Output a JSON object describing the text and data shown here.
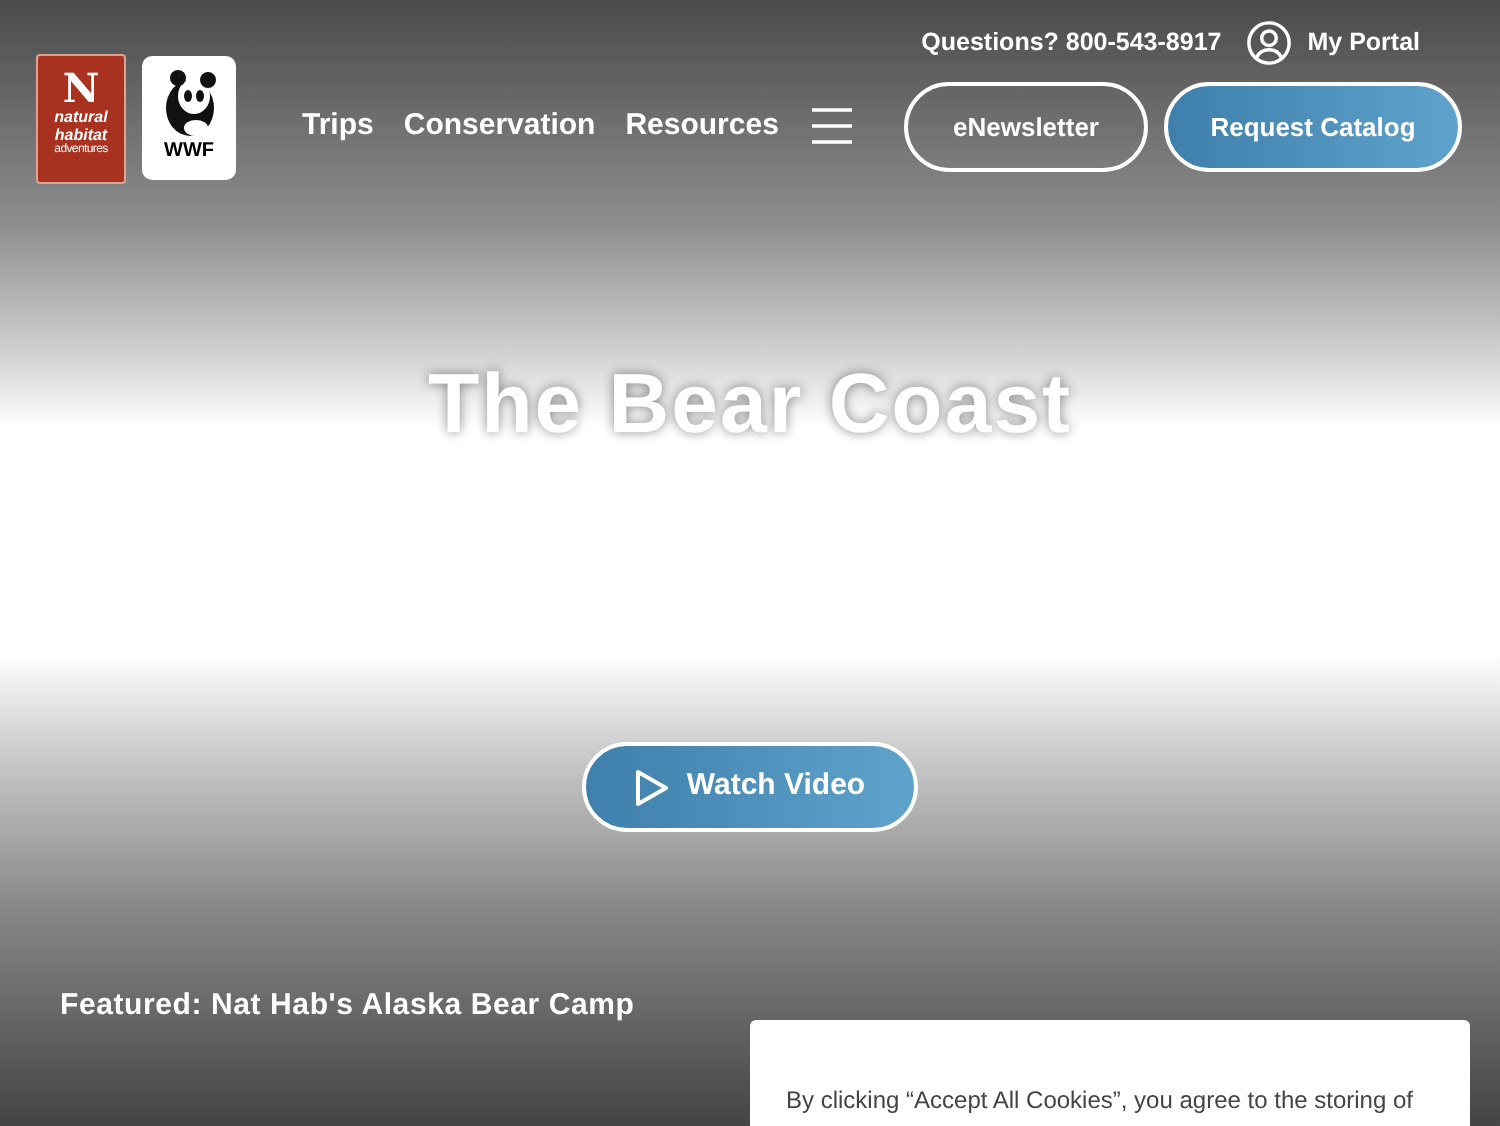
{
  "logos": {
    "nat_hab": {
      "letter": "N",
      "line_1": "natural",
      "line_2": "habitat",
      "line_3": "adventures"
    },
    "wwf": {
      "text": "WWF"
    }
  },
  "nav": {
    "items": [
      "Trips",
      "Conservation",
      "Resources"
    ]
  },
  "utility": {
    "questions": "Questions? 800-543-8917",
    "portal": "My Portal"
  },
  "buttons": [
    {
      "label": "eNewsletter",
      "kind": "outline"
    },
    {
      "label": "Request Catalog",
      "kind": "filled"
    }
  ],
  "hero": {
    "title": "The Bear Coast",
    "video_button": "Watch Video",
    "featured": "Featured: Nat Hab's Alaska Bear Camp"
  },
  "cookie_banner": {
    "text": "By clicking “Accept All Cookies”, you agree to the storing of"
  }
}
